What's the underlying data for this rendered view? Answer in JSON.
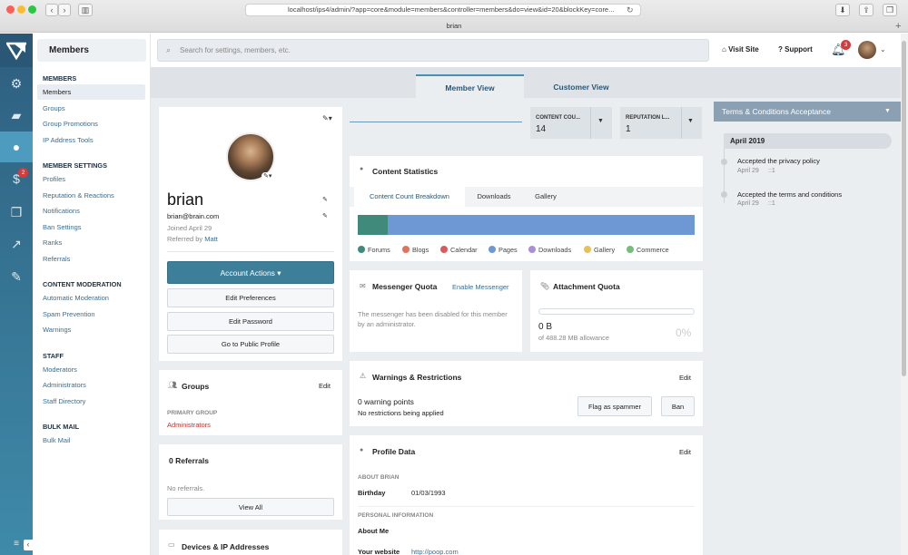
{
  "browser": {
    "url": "localhost/ips4/admin/?app=core&module=members&controller=members&do=view&id=20&blockKey=core...",
    "tab_title": "brian"
  },
  "rail": {
    "icons": [
      "logo-icon",
      "gears-icon",
      "chat-icon",
      "user-icon",
      "dollar-icon",
      "copy-icon",
      "chart-icon",
      "brush-icon",
      "menu-icon"
    ],
    "badge": "2",
    "collapse": "‹"
  },
  "nav": {
    "title": "Members",
    "sections": [
      {
        "label": "MEMBERS",
        "items": [
          "Members",
          "Groups",
          "Group Promotions",
          "IP Address Tools"
        ]
      },
      {
        "label": "MEMBER SETTINGS",
        "items": [
          "Profiles",
          "Reputation & Reactions",
          "Notifications",
          "Ban Settings",
          "Ranks",
          "Referrals"
        ]
      },
      {
        "label": "CONTENT MODERATION",
        "items": [
          "Automatic Moderation",
          "Spam Prevention",
          "Warnings"
        ]
      },
      {
        "label": "STAFF",
        "items": [
          "Moderators",
          "Administrators",
          "Staff Directory"
        ]
      },
      {
        "label": "BULK MAIL",
        "items": [
          "Bulk Mail"
        ]
      }
    ]
  },
  "topbar": {
    "search_placeholder": "Search for settings, members, etc.",
    "visit_site": "Visit Site",
    "support": "Support",
    "notif_count": "3"
  },
  "tabs": {
    "member_view": "Member View",
    "customer_view": "Customer View"
  },
  "profile": {
    "name": "brian",
    "email": "brian@brain.com",
    "joined": "Joined April 29",
    "referred_prefix": "Referred by",
    "referred_by": "Matt",
    "account_actions": "Account Actions ▾",
    "edit_preferences": "Edit Preferences",
    "edit_password": "Edit Password",
    "go_public": "Go to Public Profile"
  },
  "groups": {
    "title": "Groups",
    "edit": "Edit",
    "primary_label": "PRIMARY GROUP",
    "primary_value": "Administrators"
  },
  "referrals": {
    "title": "0 Referrals",
    "empty": "No referrals.",
    "view_all": "View All"
  },
  "devices": {
    "title": "Devices & IP Addresses"
  },
  "filters": {
    "content_count_label": "CONTENT COU...",
    "content_count_value": "14",
    "reputation_label": "REPUTATION L...",
    "reputation_value": "1"
  },
  "content_stats": {
    "title": "Content Statistics",
    "tabs": [
      "Content Count Breakdown",
      "Downloads",
      "Gallery"
    ],
    "bar_fraction_forums": 0.09,
    "legend": [
      {
        "label": "Forums",
        "color": "#3f8a7b"
      },
      {
        "label": "Blogs",
        "color": "#e0735a"
      },
      {
        "label": "Calendar",
        "color": "#d65b61"
      },
      {
        "label": "Pages",
        "color": "#6d98d4"
      },
      {
        "label": "Downloads",
        "color": "#a88fd6"
      },
      {
        "label": "Gallery",
        "color": "#e7c05c"
      },
      {
        "label": "Commerce",
        "color": "#74bd7c"
      }
    ]
  },
  "messenger": {
    "title": "Messenger Quota",
    "enable": "Enable Messenger",
    "message": "The messenger has been disabled for this member by an administrator."
  },
  "attachment": {
    "title": "Attachment Quota",
    "used": "0 B",
    "allowance": "of 488.28 MB allowance",
    "percent": "0%"
  },
  "warnings": {
    "title": "Warnings & Restrictions",
    "edit": "Edit",
    "points": "0 warning points",
    "restrictions": "No restrictions being applied",
    "flag": "Flag as spammer",
    "ban": "Ban"
  },
  "profile_data": {
    "title": "Profile Data",
    "edit": "Edit",
    "about_label": "ABOUT BRIAN",
    "birthday_label": "Birthday",
    "birthday_value": "01/03/1993",
    "personal_label": "PERSONAL INFORMATION",
    "about_me_label": "About Me",
    "website_label": "Your website",
    "website_value": "http://poop.com"
  },
  "terms": {
    "select": "Terms & Conditions Acceptance",
    "month": "April 2019",
    "events": [
      {
        "text": "Accepted the privacy policy",
        "date": "April 29",
        "ip": "::1"
      },
      {
        "text": "Accepted the terms and conditions",
        "date": "April 29",
        "ip": "::1"
      }
    ]
  }
}
